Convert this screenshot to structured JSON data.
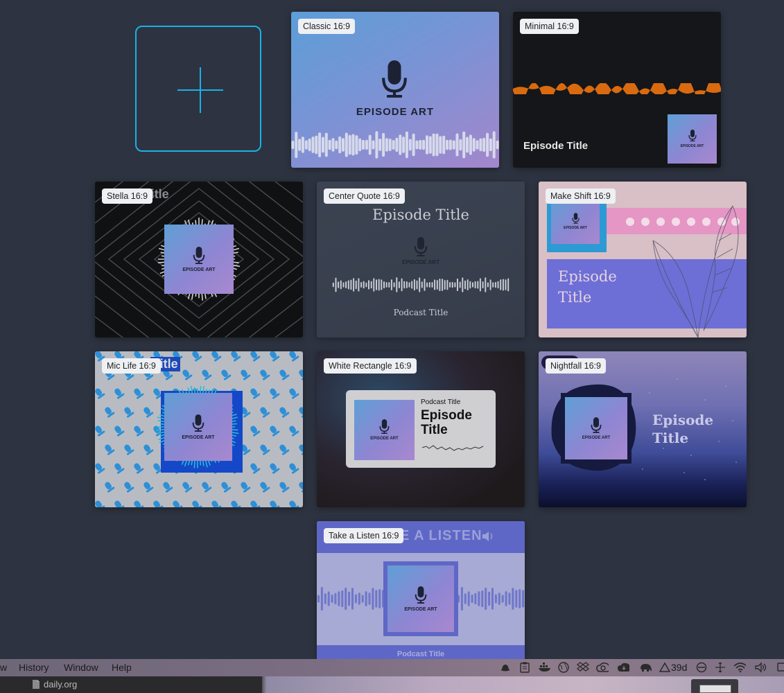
{
  "add_button": {
    "icon": "plus-icon"
  },
  "templates": [
    {
      "label": "Classic 16:9",
      "episode_art": "EPISODE ART"
    },
    {
      "label": "Minimal 16:9",
      "episode_title": "Episode Title",
      "episode_art": "EPISODE ART"
    },
    {
      "label": "Stella 16:9",
      "bg_text": "Title",
      "episode_art": "EPISODE ART"
    },
    {
      "label": "Center Quote 16:9",
      "episode_title": "Episode Title",
      "episode_art": "EPISODE ART",
      "podcast_title": "Podcast Title"
    },
    {
      "label": "Make Shift 16:9",
      "episode_title_1": "Episode",
      "episode_title_2": "Title",
      "episode_art": "EPISODE ART"
    },
    {
      "label": "Mic Life 16:9",
      "bg_text": "Title",
      "episode_art": "EPISODE ART"
    },
    {
      "label": "White Rectangle 16:9",
      "podcast_title": "Podcast Title",
      "episode_title_1": "Episode",
      "episode_title_2": "Title",
      "episode_art": "EPISODE ART"
    },
    {
      "label": "Nightfall 16:9",
      "episode_title_1": "Episode",
      "episode_title_2": "Title",
      "episode_art": "EPISODE ART"
    },
    {
      "label": "Take a Listen 16:9",
      "banner_text": "E A LISTEN",
      "episode_art": "EPISODE ART",
      "podcast_title": "Podcast Title"
    }
  ],
  "menubar": {
    "items": [
      "w",
      "History",
      "Window",
      "Help"
    ],
    "status_text": "39d",
    "tray_icons": [
      "hat-icon",
      "clipboard-icon",
      "docker-icon",
      "globe-icon",
      "dropbox-icon",
      "creative-cloud-icon",
      "cloud-download-icon",
      "elephant-icon",
      "delta-icon",
      "circle-slash-icon",
      "move-icon",
      "wifi-icon",
      "volume-icon",
      "display-icon"
    ]
  },
  "dock": {
    "file_name": "daily.org"
  },
  "colors": {
    "accent": "#19b2e6",
    "background": "#2d3340",
    "episode_gradient_start": "#5f9fd6",
    "episode_gradient_end": "#a888cf"
  }
}
